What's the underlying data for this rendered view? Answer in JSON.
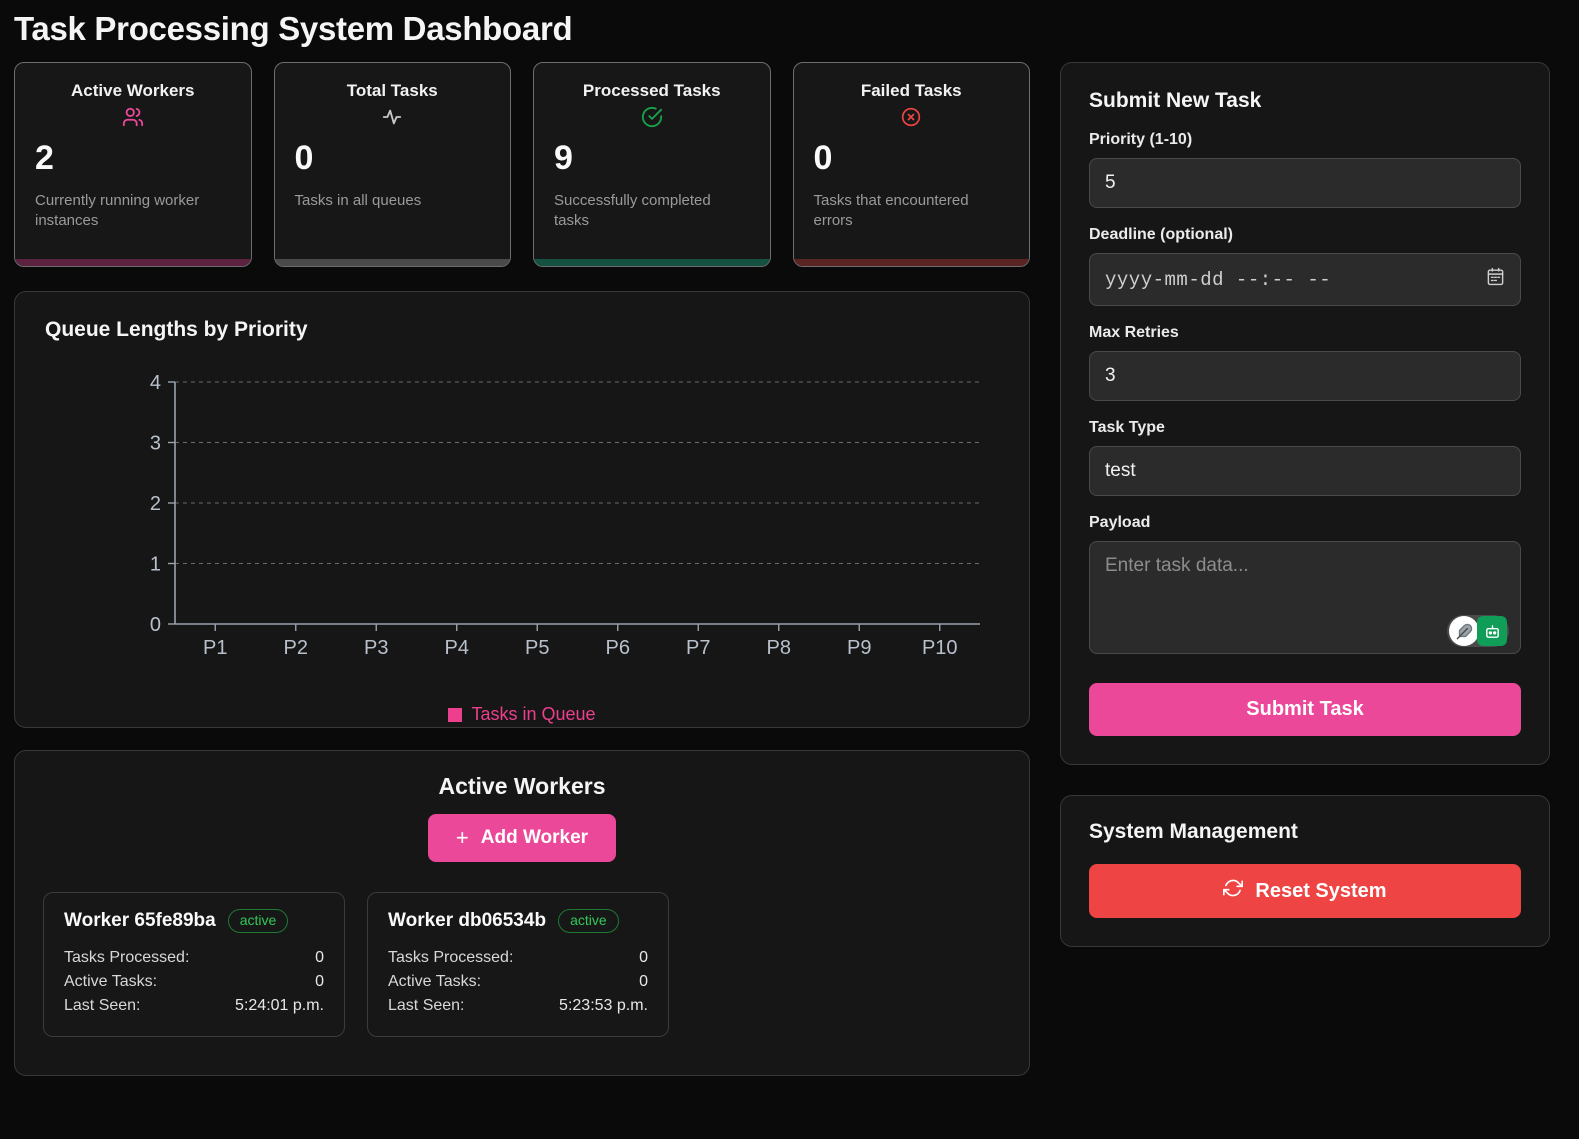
{
  "page": {
    "title": "Task Processing System Dashboard"
  },
  "colors": {
    "background": "#0a0a0a",
    "panel": "#161616",
    "accent_pink": "#ec4899",
    "legend_pink": "#ec3f8e",
    "success_green": "#16a34a",
    "badge_green": "#34c759",
    "danger_red": "#ef4444",
    "muted": "#9a9a9a"
  },
  "stats": [
    {
      "title": "Active Workers",
      "icon": "users-icon",
      "icon_color": "#ec4899",
      "accent": "#5c2240",
      "value": "2",
      "description": "Currently running worker instances"
    },
    {
      "title": "Total Tasks",
      "icon": "activity-pulse-icon",
      "icon_color": "#c9c9c9",
      "accent": "#4a4a4a",
      "value": "0",
      "description": "Tasks in all queues"
    },
    {
      "title": "Processed Tasks",
      "icon": "check-circle-icon",
      "icon_color": "#16a34a",
      "accent": "#145141",
      "value": "9",
      "description": "Successfully completed tasks"
    },
    {
      "title": "Failed Tasks",
      "icon": "x-circle-icon",
      "icon_color": "#ef4444",
      "accent": "#5a2424",
      "value": "0",
      "description": "Tasks that encountered errors"
    }
  ],
  "chart_panel": {
    "title": "Queue Lengths by Priority"
  },
  "chart_data": {
    "type": "bar",
    "title": "Queue Lengths by Priority",
    "categories": [
      "P1",
      "P2",
      "P3",
      "P4",
      "P5",
      "P6",
      "P7",
      "P8",
      "P9",
      "P10"
    ],
    "values": [
      0,
      0,
      0,
      0,
      0,
      0,
      0,
      0,
      0,
      0
    ],
    "series": [
      {
        "name": "Tasks in Queue",
        "values": [
          0,
          0,
          0,
          0,
          0,
          0,
          0,
          0,
          0,
          0
        ],
        "color": "#ec3f8e"
      }
    ],
    "xlabel": "",
    "ylabel": "",
    "ylim": [
      0,
      4
    ],
    "yticks": [
      0,
      1,
      2,
      3,
      4
    ],
    "grid": true,
    "legend": {
      "position": "bottom",
      "entries": [
        "Tasks in Queue"
      ]
    }
  },
  "workers_section": {
    "title": "Active Workers",
    "add_button": {
      "label": "Add Worker",
      "icon": "plus-icon"
    },
    "workers": [
      {
        "name": "Worker 65fe89ba",
        "status": "active",
        "rows": [
          {
            "key": "Tasks Processed:",
            "value": "0"
          },
          {
            "key": "Active Tasks:",
            "value": "0"
          },
          {
            "key": "Last Seen:",
            "value": "5:24:01 p.m."
          }
        ]
      },
      {
        "name": "Worker db06534b",
        "status": "active",
        "rows": [
          {
            "key": "Tasks Processed:",
            "value": "0"
          },
          {
            "key": "Active Tasks:",
            "value": "0"
          },
          {
            "key": "Last Seen:",
            "value": "5:23:53 p.m."
          }
        ]
      }
    ]
  },
  "submit_form": {
    "title": "Submit New Task",
    "priority": {
      "label": "Priority (1-10)",
      "value": "5"
    },
    "deadline": {
      "label": "Deadline (optional)",
      "value": "yyyy-mm-dd --:-- --",
      "icon": "calendar-icon"
    },
    "max_retries": {
      "label": "Max Retries",
      "value": "3"
    },
    "task_type": {
      "label": "Task Type",
      "value": "test"
    },
    "payload": {
      "label": "Payload",
      "value": "",
      "placeholder": "Enter task data..."
    },
    "submit_label": "Submit Task",
    "assistant_widget": {
      "quill_icon": "feather-quill-icon",
      "bot_icon": "robot-face-icon"
    }
  },
  "system_management": {
    "title": "System Management",
    "reset_label": "Reset System",
    "reset_icon": "refresh-icon"
  }
}
